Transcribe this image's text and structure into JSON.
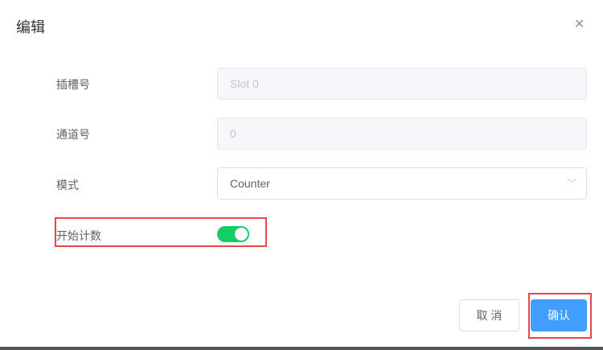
{
  "dialog": {
    "title": "编辑",
    "close_icon": "close-icon"
  },
  "form": {
    "slot": {
      "label": "插槽号",
      "value": "Slot 0"
    },
    "channel": {
      "label": "通道号",
      "value": "0"
    },
    "mode": {
      "label": "模式",
      "value": "Counter"
    },
    "start": {
      "label": "开始计数",
      "on": true,
      "color": "#13ce66"
    }
  },
  "footer": {
    "cancel": "取 消",
    "confirm": "确认"
  },
  "colors": {
    "primary": "#409eff",
    "highlight": "#e84545"
  }
}
